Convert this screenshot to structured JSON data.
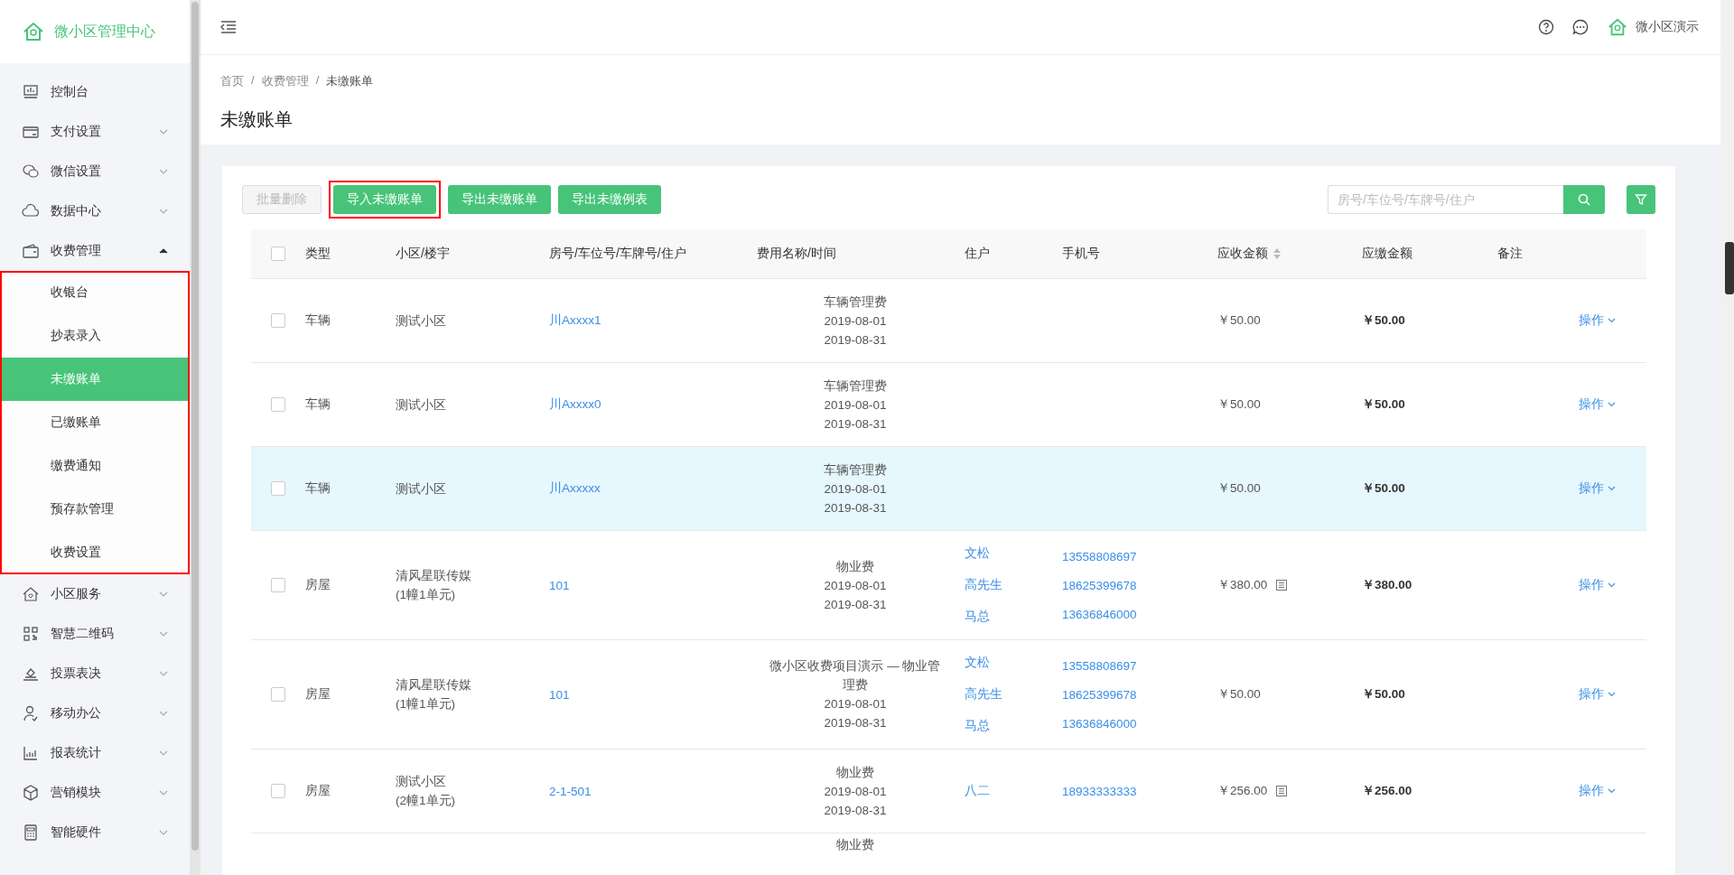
{
  "sidebar": {
    "logo": "微小区管理中心",
    "items": [
      {
        "kind": "link",
        "label": "控制台"
      },
      {
        "kind": "group",
        "label": "支付设置",
        "expanded": false
      },
      {
        "kind": "group",
        "label": "微信设置",
        "expanded": false
      },
      {
        "kind": "group",
        "label": "数据中心",
        "expanded": false
      },
      {
        "kind": "group",
        "label": "收费管理",
        "expanded": true,
        "annotated": true,
        "children": [
          {
            "label": "收银台",
            "selected": false
          },
          {
            "label": "抄表录入",
            "selected": false
          },
          {
            "label": "未缴账单",
            "selected": true
          },
          {
            "label": "已缴账单",
            "selected": false
          },
          {
            "label": "缴费通知",
            "selected": false
          },
          {
            "label": "预存款管理",
            "selected": false
          },
          {
            "label": "收费设置",
            "selected": false
          }
        ]
      },
      {
        "kind": "group",
        "label": "小区服务",
        "expanded": false
      },
      {
        "kind": "group",
        "label": "智慧二维码",
        "expanded": false
      },
      {
        "kind": "group",
        "label": "投票表决",
        "expanded": false
      },
      {
        "kind": "group",
        "label": "移动办公",
        "expanded": false
      },
      {
        "kind": "group",
        "label": "报表统计",
        "expanded": false
      },
      {
        "kind": "group",
        "label": "营销模块",
        "expanded": false
      },
      {
        "kind": "group",
        "label": "智能硬件",
        "expanded": false
      }
    ]
  },
  "header": {
    "user": "微小区演示"
  },
  "breadcrumb": {
    "separator": "/",
    "items": [
      "首页",
      "收费管理",
      "未缴账单"
    ]
  },
  "page_title": "未缴账单",
  "toolbar": {
    "buttons": [
      {
        "label": "批量删除",
        "disabled": true,
        "annotated": false
      },
      {
        "label": "导入未缴账单",
        "disabled": false,
        "annotated": true
      },
      {
        "label": "导出未缴账单",
        "disabled": false,
        "annotated": false
      },
      {
        "label": "导出未缴例表",
        "disabled": false,
        "annotated": false
      }
    ],
    "search": {
      "placeholder": "房号/车位号/车牌号/住户"
    }
  },
  "table": {
    "select_all_checked": false,
    "columns": [
      {
        "label": "类型",
        "sortable": false
      },
      {
        "label": "小区/楼宇",
        "sortable": false
      },
      {
        "label": "房号/车位号/车牌号/住户",
        "sortable": false
      },
      {
        "label": "费用名称/时间",
        "sortable": false
      },
      {
        "label": "住户",
        "sortable": false
      },
      {
        "label": "手机号",
        "sortable": false
      },
      {
        "label": "应收金额",
        "sortable": true
      },
      {
        "label": "应缴金额",
        "sortable": false
      },
      {
        "label": "备注",
        "sortable": false
      }
    ],
    "rows": [
      {
        "checked": false,
        "highlighted": false,
        "type": "车辆",
        "community": [
          "测试小区"
        ],
        "unit": "川Axxxx1",
        "fee": [
          "车辆管理费",
          "2019-08-01",
          "2019-08-31"
        ],
        "residents": [],
        "receivable": "￥50.00",
        "has_detail": false,
        "payable": "￥50.00",
        "action": "操作"
      },
      {
        "checked": false,
        "highlighted": false,
        "type": "车辆",
        "community": [
          "测试小区"
        ],
        "unit": "川Axxxx0",
        "fee": [
          "车辆管理费",
          "2019-08-01",
          "2019-08-31"
        ],
        "residents": [],
        "receivable": "￥50.00",
        "has_detail": false,
        "payable": "￥50.00",
        "action": "操作"
      },
      {
        "checked": false,
        "highlighted": true,
        "type": "车辆",
        "community": [
          "测试小区"
        ],
        "unit": "川Axxxxx",
        "fee": [
          "车辆管理费",
          "2019-08-01",
          "2019-08-31"
        ],
        "residents": [],
        "receivable": "￥50.00",
        "has_detail": false,
        "payable": "￥50.00",
        "action": "操作"
      },
      {
        "checked": false,
        "highlighted": false,
        "type": "房屋",
        "community": [
          "清风星联传媒",
          "(1幢1单元)"
        ],
        "unit": "101",
        "fee": [
          "物业费",
          "2019-08-01",
          "2019-08-31"
        ],
        "residents": [
          {
            "name": "文松",
            "phone": "13558808697"
          },
          {
            "name": "高先生",
            "phone": "18625399678"
          },
          {
            "name": "马总",
            "phone": "13636846000"
          }
        ],
        "receivable": "￥380.00",
        "has_detail": true,
        "payable": "￥380.00",
        "action": "操作"
      },
      {
        "checked": false,
        "highlighted": false,
        "type": "房屋",
        "community": [
          "清风星联传媒",
          "(1幢1单元)"
        ],
        "unit": "101",
        "fee": [
          "微小区收费项目演示 — 物业管理费",
          "2019-08-01",
          "2019-08-31"
        ],
        "residents": [
          {
            "name": "文松",
            "phone": "13558808697"
          },
          {
            "name": "高先生",
            "phone": "18625399678"
          },
          {
            "name": "马总",
            "phone": "13636846000"
          }
        ],
        "receivable": "￥50.00",
        "has_detail": false,
        "payable": "￥50.00",
        "action": "操作"
      },
      {
        "checked": false,
        "highlighted": false,
        "type": "房屋",
        "community": [
          "测试小区",
          "(2幢1单元)"
        ],
        "unit": "2-1-501",
        "fee": [
          "物业费",
          "2019-08-01",
          "2019-08-31"
        ],
        "residents": [
          {
            "name": "八二",
            "phone": "18933333333"
          }
        ],
        "receivable": "￥256.00",
        "has_detail": true,
        "payable": "￥256.00",
        "action": "操作"
      }
    ],
    "partial_row": {
      "fee": "物业费"
    }
  }
}
